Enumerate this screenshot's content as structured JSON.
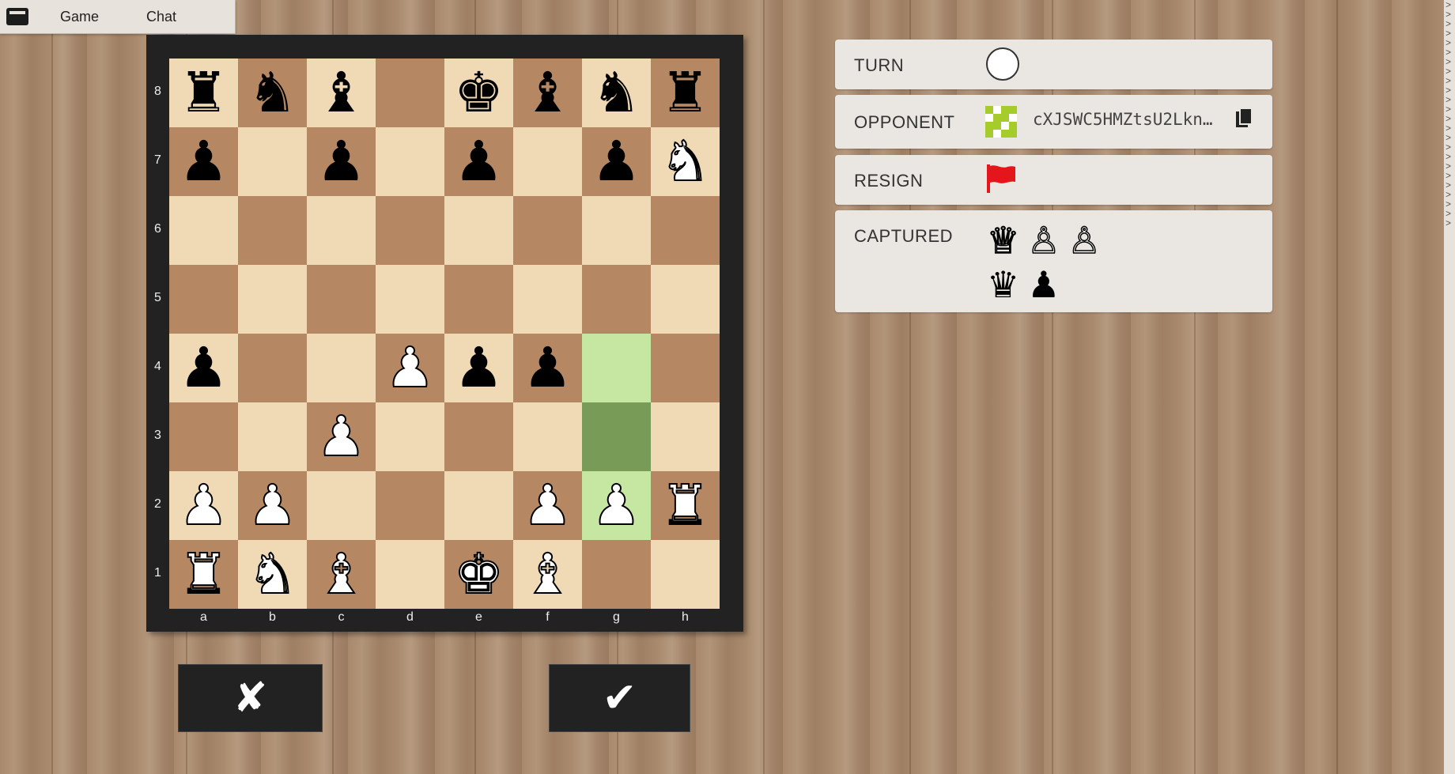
{
  "menu": {
    "tabs": [
      {
        "label": "Game"
      },
      {
        "label": "Chat"
      }
    ]
  },
  "board": {
    "files": [
      "a",
      "b",
      "c",
      "d",
      "e",
      "f",
      "g",
      "h"
    ],
    "ranks": [
      "8",
      "7",
      "6",
      "5",
      "4",
      "3",
      "2",
      "1"
    ],
    "position": [
      [
        "bR",
        "bN",
        "bB",
        "",
        "bK",
        "bB",
        "bN",
        "bR"
      ],
      [
        "bP",
        "",
        "bP",
        "",
        "bP",
        "",
        "bP",
        "wN"
      ],
      [
        "",
        "",
        "",
        "",
        "",
        "",
        "",
        ""
      ],
      [
        "",
        "",
        "",
        "",
        "",
        "",
        "",
        ""
      ],
      [
        "bP",
        "",
        "",
        "wP",
        "bP",
        "bP",
        "",
        ""
      ],
      [
        "",
        "",
        "wP",
        "",
        "",
        "",
        "",
        ""
      ],
      [
        "wP",
        "wP",
        "",
        "",
        "",
        "wP",
        "wP",
        "wR"
      ],
      [
        "wR",
        "wN",
        "wB",
        "",
        "wK",
        "wB",
        "",
        ""
      ]
    ],
    "highlighted_squares": [
      "g4",
      "g3",
      "g2"
    ]
  },
  "actions": {
    "cancel_label": "✘",
    "confirm_label": "✔"
  },
  "panel": {
    "turn_label": "TURN",
    "turn_color": "white",
    "opponent_label": "OPPONENT",
    "opponent_name": "cXJSWC5HMZtsU2Lkn…",
    "resign_label": "RESIGN",
    "captured_label": "CAPTURED",
    "captured_white": [
      "♕",
      "♙",
      "♙"
    ],
    "captured_black": [
      "♛",
      "♟"
    ]
  },
  "colors": {
    "light_square": "#f0d9b5",
    "dark_square": "#b58863",
    "highlight_light": "#c6e7a2",
    "highlight_dark": "#789c57",
    "flag": "#e4161b",
    "avatar": "#a6cc2c"
  },
  "icons": {
    "window": "app-icon",
    "copy": "copy-icon",
    "resign": "flag-icon"
  }
}
